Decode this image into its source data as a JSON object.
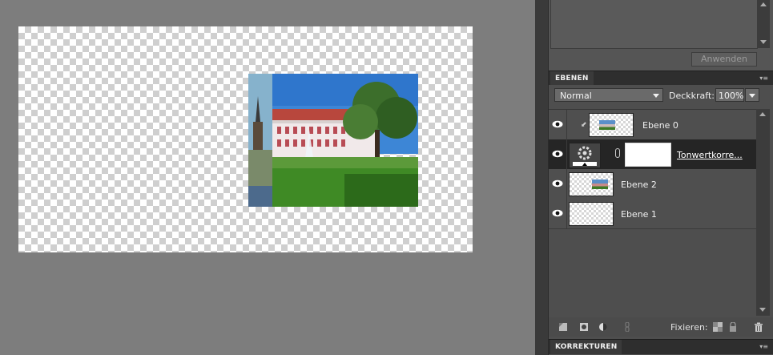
{
  "top_panel": {
    "apply_label": "Anwenden"
  },
  "layers_panel": {
    "tab_label": "EBENEN",
    "blend_mode": "Normal",
    "opacity_label": "Deckkraft:",
    "opacity_value": "100%",
    "layers": [
      {
        "name": "Ebene 0",
        "visible": true,
        "selected": false,
        "clipped": true
      },
      {
        "name": "Tonwertkorre...",
        "visible": true,
        "selected": true,
        "adjustment": true
      },
      {
        "name": "Ebene 2",
        "visible": true,
        "selected": false
      },
      {
        "name": "Ebene 1",
        "visible": true,
        "selected": false
      }
    ],
    "lock_label": "Fixieren:",
    "toolbar_icons": [
      "new-layer-icon",
      "mask-icon",
      "adjustment-icon",
      "link-icon",
      "lock-transparency-icon",
      "lock-all-icon",
      "trash-icon"
    ]
  },
  "corrections_panel": {
    "tab_label": "KORREKTUREN"
  },
  "colors": {
    "panel_bg": "#4f4f4f",
    "selected_row": "#252525",
    "canvas_bg": "#7d7d7d"
  }
}
